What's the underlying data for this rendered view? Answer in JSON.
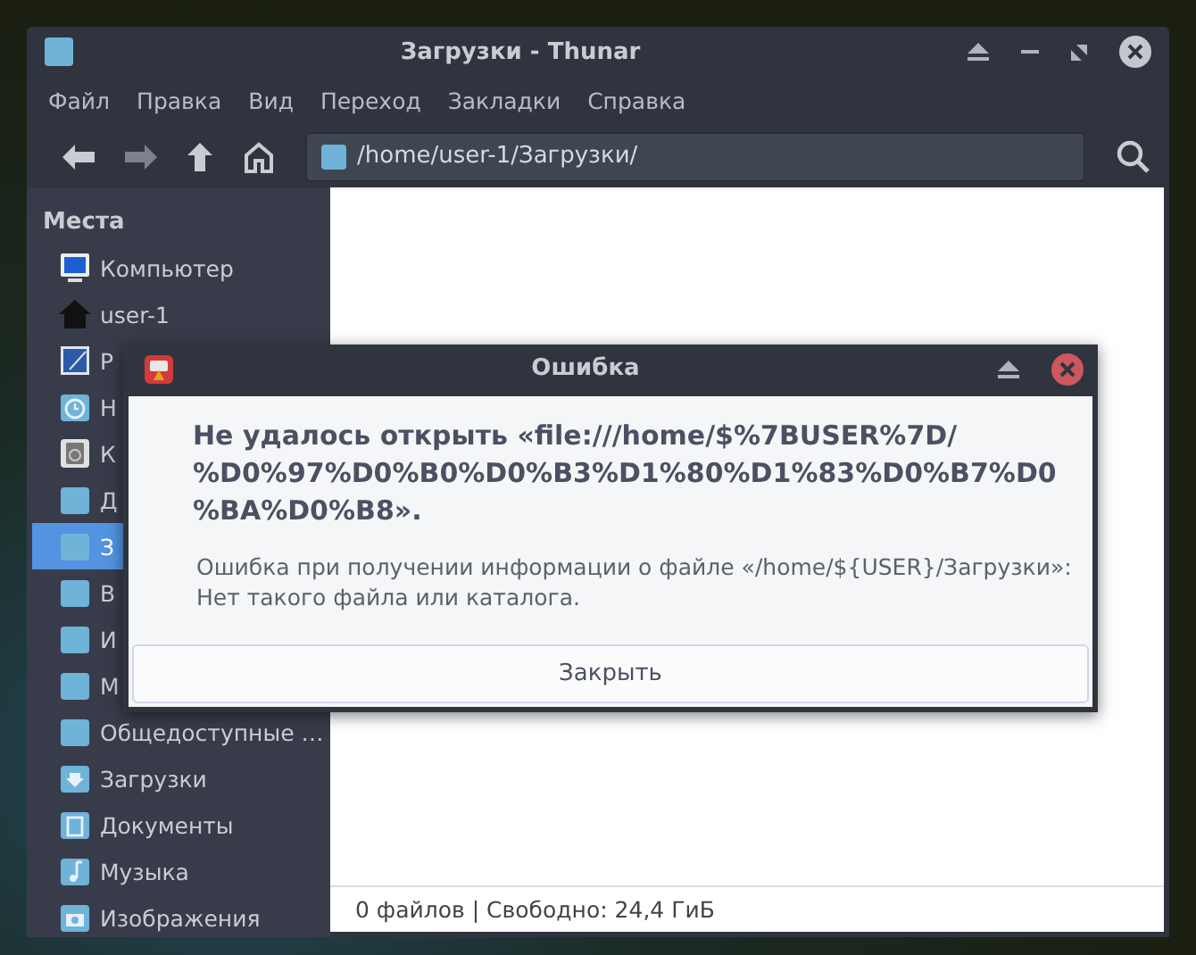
{
  "window": {
    "title": "Загрузки - Thunar"
  },
  "menu": [
    "Файл",
    "Правка",
    "Вид",
    "Переход",
    "Закладки",
    "Справка"
  ],
  "location": {
    "value": "/home/user-1/Загрузки/"
  },
  "sidebar": {
    "heading": "Места",
    "items": [
      {
        "label": "Компьютер",
        "kind": "computer",
        "selected": false
      },
      {
        "label": "user-1",
        "kind": "home",
        "selected": false
      },
      {
        "label": "Р",
        "kind": "desktop",
        "selected": false
      },
      {
        "label": "Н",
        "kind": "recent",
        "selected": false
      },
      {
        "label": "К",
        "kind": "trash",
        "selected": false
      },
      {
        "label": "Д",
        "kind": "folder",
        "selected": false
      },
      {
        "label": "З",
        "kind": "folder",
        "selected": true
      },
      {
        "label": "В",
        "kind": "folder",
        "selected": false
      },
      {
        "label": "И",
        "kind": "folder",
        "selected": false
      },
      {
        "label": "М",
        "kind": "folder",
        "selected": false
      },
      {
        "label": "Общедоступные …",
        "kind": "folder",
        "selected": false
      },
      {
        "label": "Загрузки",
        "kind": "downloads",
        "selected": false
      },
      {
        "label": "Документы",
        "kind": "documents",
        "selected": false
      },
      {
        "label": "Музыка",
        "kind": "music",
        "selected": false
      },
      {
        "label": "Изображения",
        "kind": "pictures",
        "selected": false
      }
    ]
  },
  "status_bar": "0 файлов | Свободно: 24,4 ГиБ",
  "dialog": {
    "title": "Ошибка",
    "heading": [
      "Не удалось открыть «file:///home/$%7BUSER%7D/",
      "%D0%97%D0%B0%D0%B3%D1%80%D1%83%D0%B7%D0",
      "%BA%D0%B8»."
    ],
    "message": [
      "Ошибка при получении информации о файле «/home/${USER}/Загрузки»:",
      "Нет такого файла или каталога."
    ],
    "button": "Закрыть"
  }
}
